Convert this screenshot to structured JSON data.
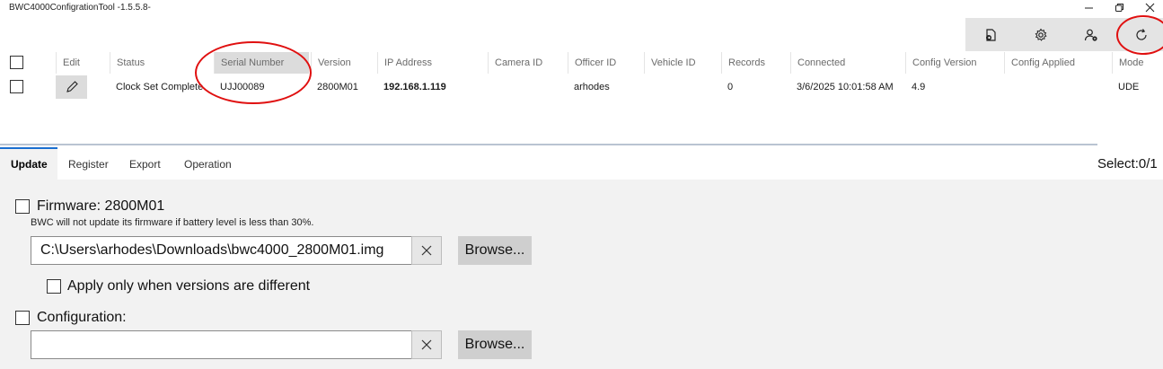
{
  "window": {
    "title": "BWC4000ConfigrationTool -1.5.5.8-",
    "controls": [
      "minimize-icon",
      "restore-icon",
      "close-icon"
    ]
  },
  "toolbar": {
    "buttons": [
      "export-device-icon",
      "settings-gear-icon",
      "user-settings-icon",
      "refresh-icon"
    ]
  },
  "table": {
    "headers": {
      "edit": "Edit",
      "status": "Status",
      "serial": "Serial Number",
      "version": "Version",
      "ip": "IP Address",
      "camera": "Camera ID",
      "officer": "Officer ID",
      "vehicle": "Vehicle ID",
      "records": "Records",
      "connected": "Connected",
      "config_version": "Config Version",
      "config_applied": "Config Applied",
      "mode": "Mode"
    },
    "rows": [
      {
        "status": "Clock Set Complete",
        "serial": "UJJ00089",
        "version": "2800M01",
        "ip": "192.168.1.119",
        "camera": "",
        "officer": "arhodes",
        "vehicle": "",
        "records": "0",
        "connected": "3/6/2025 10:01:58 AM",
        "config_version": "4.9",
        "config_applied": "",
        "mode": "UDE"
      }
    ]
  },
  "tabs": {
    "items": [
      "Update",
      "Register",
      "Export",
      "Operation"
    ],
    "active": "Update",
    "select_count": "Select:0/1"
  },
  "update_panel": {
    "firmware_label": "Firmware: 2800M01",
    "firmware_note": "BWC will not update its firmware if battery level is less than 30%.",
    "firmware_path": "C:\\Users\\arhodes\\Downloads\\bwc4000_2800M01.img",
    "browse_label": "Browse...",
    "apply_label": "Apply only when versions are different",
    "configuration_label": "Configuration:",
    "configuration_path": ""
  },
  "colors": {
    "annotation_circle": "#e01010",
    "active_tab_accent": "#1a6fd0"
  }
}
